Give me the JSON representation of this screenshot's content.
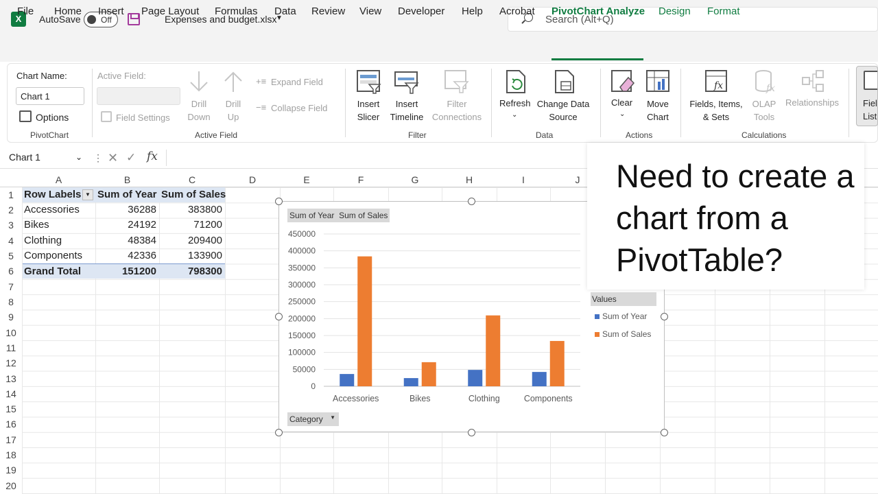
{
  "titlebar": {
    "app_logo": "X",
    "autosave_label": "AutoSave",
    "autosave_state": "Off",
    "file_name": "Expenses and budget.xlsx",
    "search_placeholder": "Search (Alt+Q)"
  },
  "menu_tabs": [
    "File",
    "Home",
    "Insert",
    "Page Layout",
    "Formulas",
    "Data",
    "Review",
    "View",
    "Developer",
    "Help",
    "Acrobat",
    "PivotChart Analyze",
    "Design",
    "Format"
  ],
  "active_tab": "PivotChart Analyze",
  "ribbon": {
    "pivotchart": {
      "chart_name_label": "Chart Name:",
      "chart_name_value": "Chart 1",
      "options_label": "Options",
      "group_label": "PivotChart"
    },
    "active_field": {
      "active_field_label": "Active Field:",
      "field_settings_label": "Field Settings",
      "drill_down_label": "Drill Down",
      "drill_up_label": "Drill Up",
      "expand_field_label": "Expand Field",
      "collapse_field_label": "Collapse Field",
      "group_label": "Active Field"
    },
    "filter": {
      "insert_slicer_label": "Insert Slicer",
      "insert_timeline_label": "Insert Timeline",
      "filter_connections_label": "Filter Connections",
      "group_label": "Filter"
    },
    "data": {
      "refresh_label": "Refresh",
      "change_data_source_label": "Change Data Source",
      "group_label": "Data"
    },
    "actions": {
      "clear_label": "Clear",
      "move_chart_label": "Move Chart",
      "group_label": "Actions"
    },
    "calculations": {
      "fields_items_sets_label": "Fields, Items, & Sets",
      "olap_tools_label": "OLAP Tools",
      "relationships_label": "Relationships",
      "group_label": "Calculations"
    },
    "show": {
      "field_list_label": "Field List"
    }
  },
  "formula_bar": {
    "name_box": "Chart 1",
    "fx": "fx",
    "formula": ""
  },
  "grid": {
    "columns": [
      "A",
      "B",
      "C",
      "D",
      "E",
      "F",
      "G",
      "H",
      "I",
      "J"
    ],
    "rows": [
      "1",
      "2",
      "3",
      "4",
      "5",
      "6",
      "7",
      "8",
      "9",
      "10",
      "11",
      "12",
      "13",
      "14",
      "15",
      "16",
      "17",
      "18",
      "19",
      "20"
    ]
  },
  "pivot_table": {
    "headers": [
      "Row Labels",
      "Sum of Year",
      "Sum of Sales"
    ],
    "rows": [
      {
        "label": "Accessories",
        "year": "36288",
        "sales": "383800"
      },
      {
        "label": "Bikes",
        "year": "24192",
        "sales": "71200"
      },
      {
        "label": "Clothing",
        "year": "48384",
        "sales": "209400"
      },
      {
        "label": "Components",
        "year": "42336",
        "sales": "133900"
      }
    ],
    "total": {
      "label": "Grand Total",
      "year": "151200",
      "sales": "798300"
    }
  },
  "chart_data": {
    "type": "bar",
    "categories": [
      "Accessories",
      "Bikes",
      "Clothing",
      "Components"
    ],
    "series": [
      {
        "name": "Sum of Year",
        "values": [
          36288,
          24192,
          48384,
          42336
        ],
        "color": "#4472c4"
      },
      {
        "name": "Sum of Sales",
        "values": [
          383800,
          71200,
          209400,
          133900
        ],
        "color": "#ed7d31"
      }
    ],
    "ylim": [
      0,
      450000
    ],
    "yticks": [
      "0",
      "50000",
      "100000",
      "150000",
      "200000",
      "250000",
      "300000",
      "350000",
      "400000",
      "450000"
    ],
    "legend_title": "Values",
    "legend_position": "right",
    "value_field_buttons": [
      "Sum of Year",
      "Sum of Sales"
    ],
    "axis_field_button": "Category",
    "grid": true
  },
  "callout": {
    "text": "Need to create a chart from a PivotTable?"
  }
}
